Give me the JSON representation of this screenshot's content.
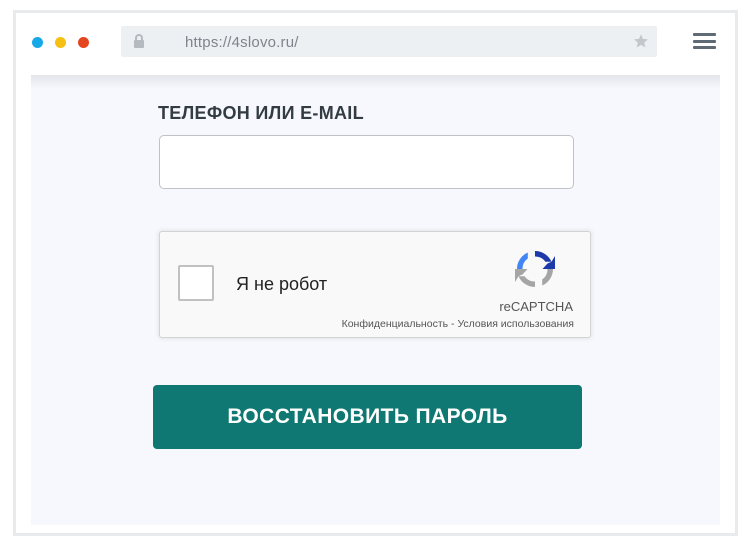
{
  "browser": {
    "url": "https://4slovo.ru/",
    "colors": {
      "dot_blue": "#16a9e8",
      "dot_yellow": "#f6c013",
      "dot_red": "#e3461f"
    },
    "icons": [
      "lock-icon",
      "star-icon",
      "hamburger-menu-icon"
    ]
  },
  "form": {
    "field_label": "ТЕЛЕФОН ИЛИ E-MAIL",
    "field_value": "",
    "captcha": {
      "checkbox_label": "Я не робот",
      "brand": "reCAPTCHA",
      "privacy_link": "Конфиденциальность",
      "separator": "-",
      "terms_link": "Условия использования"
    },
    "submit_label": "ВОССТАНОВИТЬ ПАРОЛЬ",
    "accent_color": "#0f7872"
  }
}
